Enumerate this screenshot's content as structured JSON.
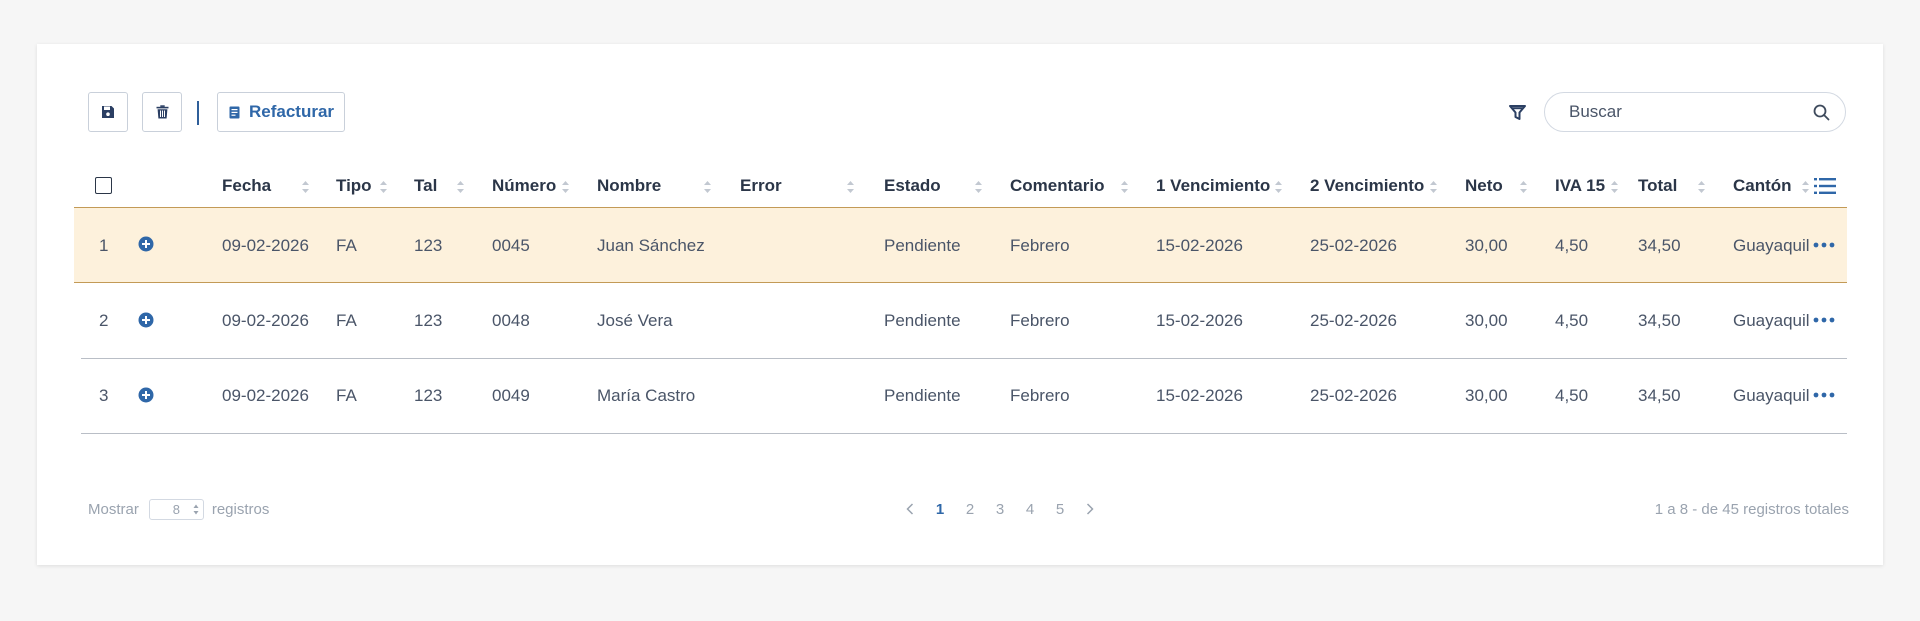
{
  "toolbar": {
    "save_icon": "floppy-disk-icon",
    "delete_icon": "trash-icon",
    "refacturar_label": "Refacturar",
    "filter_icon": "funnel-icon",
    "search_placeholder": "Buscar",
    "search_value": ""
  },
  "table": {
    "columns": [
      "Fecha",
      "Tipo",
      "Tal",
      "Número",
      "Nombre",
      "Error",
      "Estado",
      "Comentario",
      "1 Vencimiento",
      "2 Vencimiento",
      "Neto",
      "IVA 15",
      "Total",
      "Cantón"
    ],
    "rows": [
      {
        "n": "1",
        "fecha": "09-02-2026",
        "tipo": "FA",
        "tal": "123",
        "numero": "0045",
        "nombre": "Juan Sánchez",
        "error": "",
        "estado": "Pendiente",
        "comentario": "Febrero",
        "venc1": "15-02-2026",
        "venc2": "25-02-2026",
        "neto": "30,00",
        "iva": "4,50",
        "total": "34,50",
        "canton": "Guayaquil",
        "highlighted": true
      },
      {
        "n": "2",
        "fecha": "09-02-2026",
        "tipo": "FA",
        "tal": "123",
        "numero": "0048",
        "nombre": "José Vera",
        "error": "",
        "estado": "Pendiente",
        "comentario": "Febrero",
        "venc1": "15-02-2026",
        "venc2": "25-02-2026",
        "neto": "30,00",
        "iva": "4,50",
        "total": "34,50",
        "canton": "Guayaquil",
        "highlighted": false
      },
      {
        "n": "3",
        "fecha": "09-02-2026",
        "tipo": "FA",
        "tal": "123",
        "numero": "0049",
        "nombre": "María Castro",
        "error": "",
        "estado": "Pendiente",
        "comentario": "Febrero",
        "venc1": "15-02-2026",
        "venc2": "25-02-2026",
        "neto": "30,00",
        "iva": "4,50",
        "total": "34,50",
        "canton": "Guayaquil",
        "highlighted": false
      }
    ]
  },
  "footer": {
    "show_label": "Mostrar",
    "per_page": "8",
    "records_label": "registros",
    "pages": [
      "1",
      "2",
      "3",
      "4",
      "5"
    ],
    "current_page": "1",
    "summary": "1 a 8 - de 45 registros totales"
  },
  "colors": {
    "accent": "#2f67a8",
    "highlight_row": "#fdf1dc",
    "highlight_border": "#c39a56"
  }
}
